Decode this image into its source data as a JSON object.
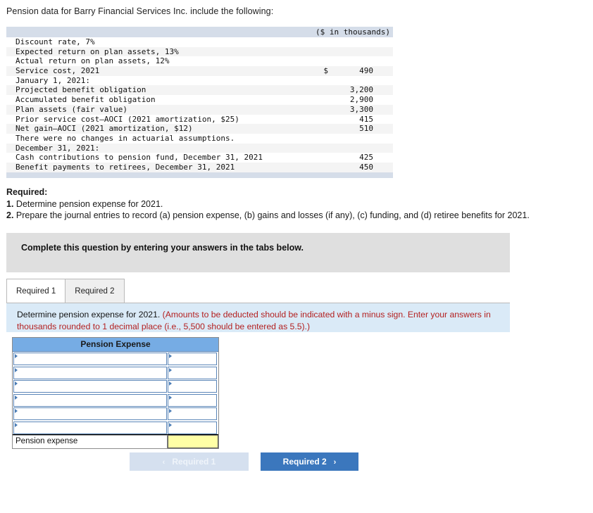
{
  "intro": "Pension data for Barry Financial Services Inc. include the following:",
  "data_table": {
    "units_header": "($ in thousands)",
    "rows": [
      {
        "label": "Discount rate, 7%",
        "symbol": "",
        "value": ""
      },
      {
        "label": "Expected return on plan assets, 13%",
        "symbol": "",
        "value": ""
      },
      {
        "label": "Actual return on plan assets, 12%",
        "symbol": "",
        "value": ""
      },
      {
        "label": "Service cost, 2021",
        "symbol": "$",
        "value": "490"
      },
      {
        "label": "January 1, 2021:",
        "symbol": "",
        "value": ""
      },
      {
        "label": "Projected benefit obligation",
        "symbol": "",
        "value": "3,200"
      },
      {
        "label": "Accumulated benefit obligation",
        "symbol": "",
        "value": "2,900"
      },
      {
        "label": "Plan assets (fair value)",
        "symbol": "",
        "value": "3,300"
      },
      {
        "label": "Prior service cost–AOCI (2021 amortization, $25)",
        "symbol": "",
        "value": "415"
      },
      {
        "label": "Net gain–AOCI (2021 amortization, $12)",
        "symbol": "",
        "value": "510"
      },
      {
        "label": "There were no changes in actuarial assumptions.",
        "symbol": "",
        "value": ""
      },
      {
        "label": "December 31, 2021:",
        "symbol": "",
        "value": ""
      },
      {
        "label": "Cash contributions to pension fund, December 31, 2021",
        "symbol": "",
        "value": "425"
      },
      {
        "label": "Benefit payments to retirees, December 31, 2021",
        "symbol": "",
        "value": "450"
      }
    ]
  },
  "required": {
    "heading": "Required:",
    "item1_num": "1.",
    "item1": "Determine pension expense for 2021.",
    "item2_num": "2.",
    "item2": "Prepare the journal entries to record (a) pension expense, (b) gains and losses (if any), (c) funding, and (d) retiree benefits for 2021."
  },
  "prompt_panel": {
    "text": "Complete this question by entering your answers in the tabs below."
  },
  "tabs": [
    {
      "label": "Required 1",
      "active": true
    },
    {
      "label": "Required 2",
      "active": false
    }
  ],
  "instruction": {
    "black_text": "Determine pension expense for 2021.",
    "red_text": "(Amounts to be deducted should be indicated with a minus sign. Enter your answers in thousands rounded to 1 decimal place (i.e., 5,500 should be entered as 5.5).)"
  },
  "answer_grid": {
    "header": "Pension Expense",
    "input_rows": [
      {
        "description": "",
        "amount": ""
      },
      {
        "description": "",
        "amount": ""
      },
      {
        "description": "",
        "amount": ""
      },
      {
        "description": "",
        "amount": ""
      },
      {
        "description": "",
        "amount": ""
      },
      {
        "description": "",
        "amount": ""
      }
    ],
    "total_label": "Pension expense",
    "total_value": ""
  },
  "nav": {
    "prev_label": "Required 1",
    "prev_chevron": "‹",
    "next_label": "Required 2",
    "next_chevron": "›"
  },
  "colors": {
    "header_blue": "#76ace4",
    "banner_blue_gray": "#d5dde9",
    "instruction_blue": "#daeaf7",
    "panel_gray": "#dfdfdf",
    "total_yellow": "#ffffa6",
    "button_active": "#3b77bd",
    "button_disabled": "#d5e0ef",
    "red_text": "#b32020"
  }
}
